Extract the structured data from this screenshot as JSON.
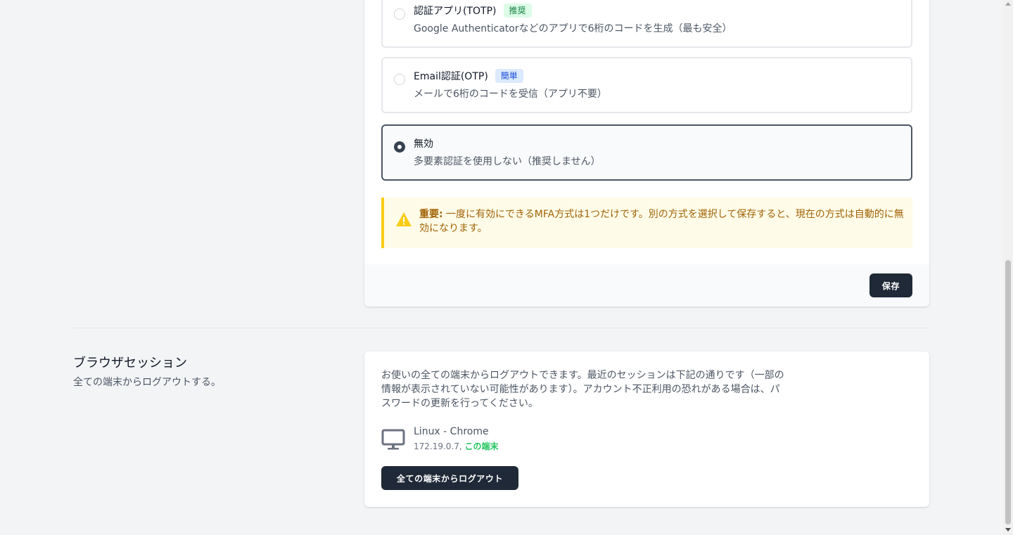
{
  "mfa": {
    "options": [
      {
        "title": "認証アプリ(TOTP)",
        "badge": "推奨",
        "desc": "Google Authenticatorなどのアプリで6桁のコードを生成（最も安全）",
        "selected": false
      },
      {
        "title": "Email認証(OTP)",
        "badge": "簡単",
        "desc": "メールで6桁のコードを受信（アプリ不要）",
        "selected": false
      },
      {
        "title": "無効",
        "desc": "多要素認証を使用しない（推奨しません）",
        "selected": true
      }
    ],
    "warning": {
      "strong": "重要:",
      "text": " 一度に有効にできるMFA方式は1つだけです。別の方式を選択して保存すると、現在の方式は自動的に無効になります。"
    },
    "save_label": "保存"
  },
  "browser_sessions": {
    "title": "ブラウザセッション",
    "description": "全ての端末からログアウトする。",
    "intro": "お使いの全ての端末からログアウトできます。最近のセッションは下記の通りです（一部の情報が表示されていない可能性があります）。アカウント不正利用の恐れがある場合は、パスワードの更新を行ってください。",
    "device": {
      "name": "Linux - Chrome",
      "ip": "172.19.0.7,",
      "current_label": "この端末"
    },
    "logout_label": "全ての端末からログアウト"
  },
  "colors": {
    "accent_dark": "#1f2937",
    "warning_bg": "#fefce8",
    "warning_border": "#facc15",
    "warning_text": "#a16207",
    "current_device": "#22c55e"
  }
}
